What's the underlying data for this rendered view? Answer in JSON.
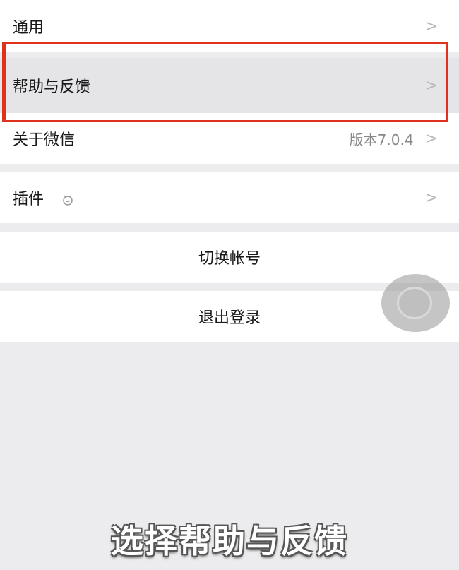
{
  "menu": {
    "general": {
      "label": "通用"
    },
    "help_feedback": {
      "label": "帮助与反馈"
    },
    "about": {
      "label": "关于微信",
      "version": "版本7.0.4"
    },
    "plugins": {
      "label": "插件"
    },
    "switch_account": {
      "label": "切换帐号"
    },
    "logout": {
      "label": "退出登录"
    }
  },
  "chevron": ">",
  "caption": "选择帮助与反馈",
  "colors": {
    "highlight": "#e0301e",
    "background": "#ececee"
  }
}
